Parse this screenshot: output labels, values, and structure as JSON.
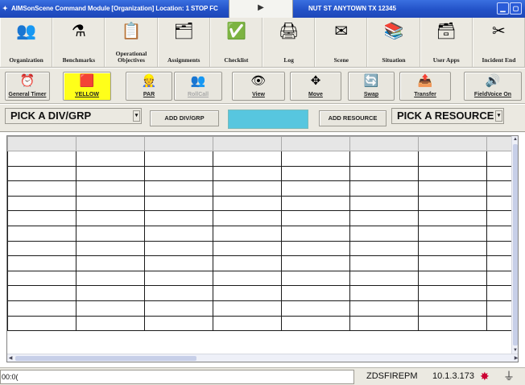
{
  "window": {
    "title": "AIMSonScene Command Module [Organization] Location: 1 STOP FC",
    "title_right": "NUT ST ANYTOWN TX 12345",
    "play_symbol": "▶"
  },
  "toolbar_main": [
    {
      "label": "Organization",
      "icon": "people-icon",
      "glyph": "👥"
    },
    {
      "label": "Benchmarks",
      "icon": "flask-icon",
      "glyph": "⚗"
    },
    {
      "label": "Operational Objectives",
      "icon": "target-icon",
      "glyph": "📋"
    },
    {
      "label": "Assignments",
      "icon": "assignments-icon",
      "glyph": "🗂"
    },
    {
      "label": "Checklist",
      "icon": "checklist-icon",
      "glyph": "✅"
    },
    {
      "label": "Log",
      "icon": "printer-icon",
      "glyph": "🖨"
    },
    {
      "label": "Scene",
      "icon": "scene-icon",
      "glyph": "✉"
    },
    {
      "label": "Situation",
      "icon": "situation-icon",
      "glyph": "📚"
    },
    {
      "label": "User Apps",
      "icon": "apps-icon",
      "glyph": "🗃"
    },
    {
      "label": "Incident End",
      "icon": "scissors-icon",
      "glyph": "✂"
    }
  ],
  "toolbar_secondary": [
    {
      "label": "General Timer",
      "icon": "clock-icon",
      "glyph": "⏰",
      "state": "normal"
    },
    {
      "label": "YELLOW",
      "icon": "flag-icon",
      "glyph": "🟥",
      "state": "yellow"
    },
    {
      "label": "PAR",
      "icon": "firefighter-icon",
      "glyph": "👷",
      "state": "normal"
    },
    {
      "label": "RollCall",
      "icon": "rollcall-icon",
      "glyph": "👥",
      "state": "disabled"
    },
    {
      "label": "View",
      "icon": "eye-icon",
      "glyph": "👁",
      "state": "normal"
    },
    {
      "label": "Move",
      "icon": "move-icon",
      "glyph": "✥",
      "state": "normal"
    },
    {
      "label": "Swap",
      "icon": "swap-icon",
      "glyph": "🔄",
      "state": "normal"
    },
    {
      "label": "Transfer",
      "icon": "transfer-icon",
      "glyph": "📤",
      "state": "normal"
    },
    {
      "label": "FieldVoice On",
      "icon": "speaker-icon",
      "glyph": "🔊",
      "state": "normal"
    }
  ],
  "selectors": {
    "div_grp": "PICK A DIV/GRP",
    "add_div_grp": "ADD DIV/GRP",
    "add_resource": "ADD RESOURCE",
    "resource": "PICK A RESOURCE",
    "dropdown_arrow": "▾",
    "highlight_color": "#57c6df"
  },
  "grid": {
    "columns": 7,
    "rows": 13
  },
  "status": {
    "time": "00:0(",
    "user": "ZDSFIREPM",
    "ip": "10.1.3.173"
  }
}
